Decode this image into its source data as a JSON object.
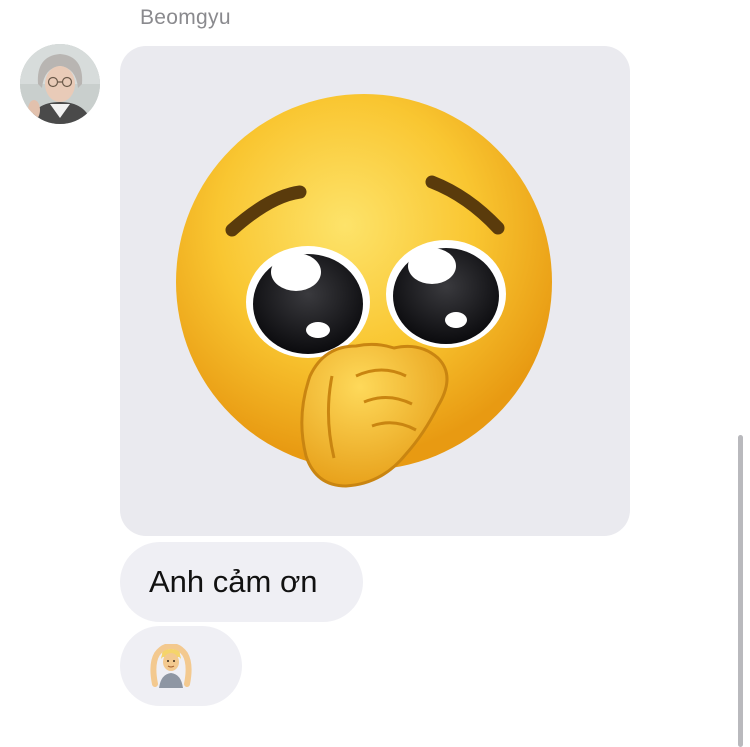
{
  "conversation": {
    "sender_name": "Beomgyu",
    "messages": [
      {
        "type": "image",
        "content_icon": "pleading-face-hand-over-mouth-emoji"
      },
      {
        "type": "text",
        "text": "Anh cảm ơn"
      },
      {
        "type": "emoji",
        "content_icon": "person-gesturing-ok-emoji"
      }
    ]
  },
  "avatar": {
    "icon": "user-avatar-photo"
  },
  "colors": {
    "bubble_background": "#efeff4",
    "image_background": "#eaeaef",
    "sender_name_color": "#8a8a8e",
    "emoji_yellow": "#f9c631"
  }
}
